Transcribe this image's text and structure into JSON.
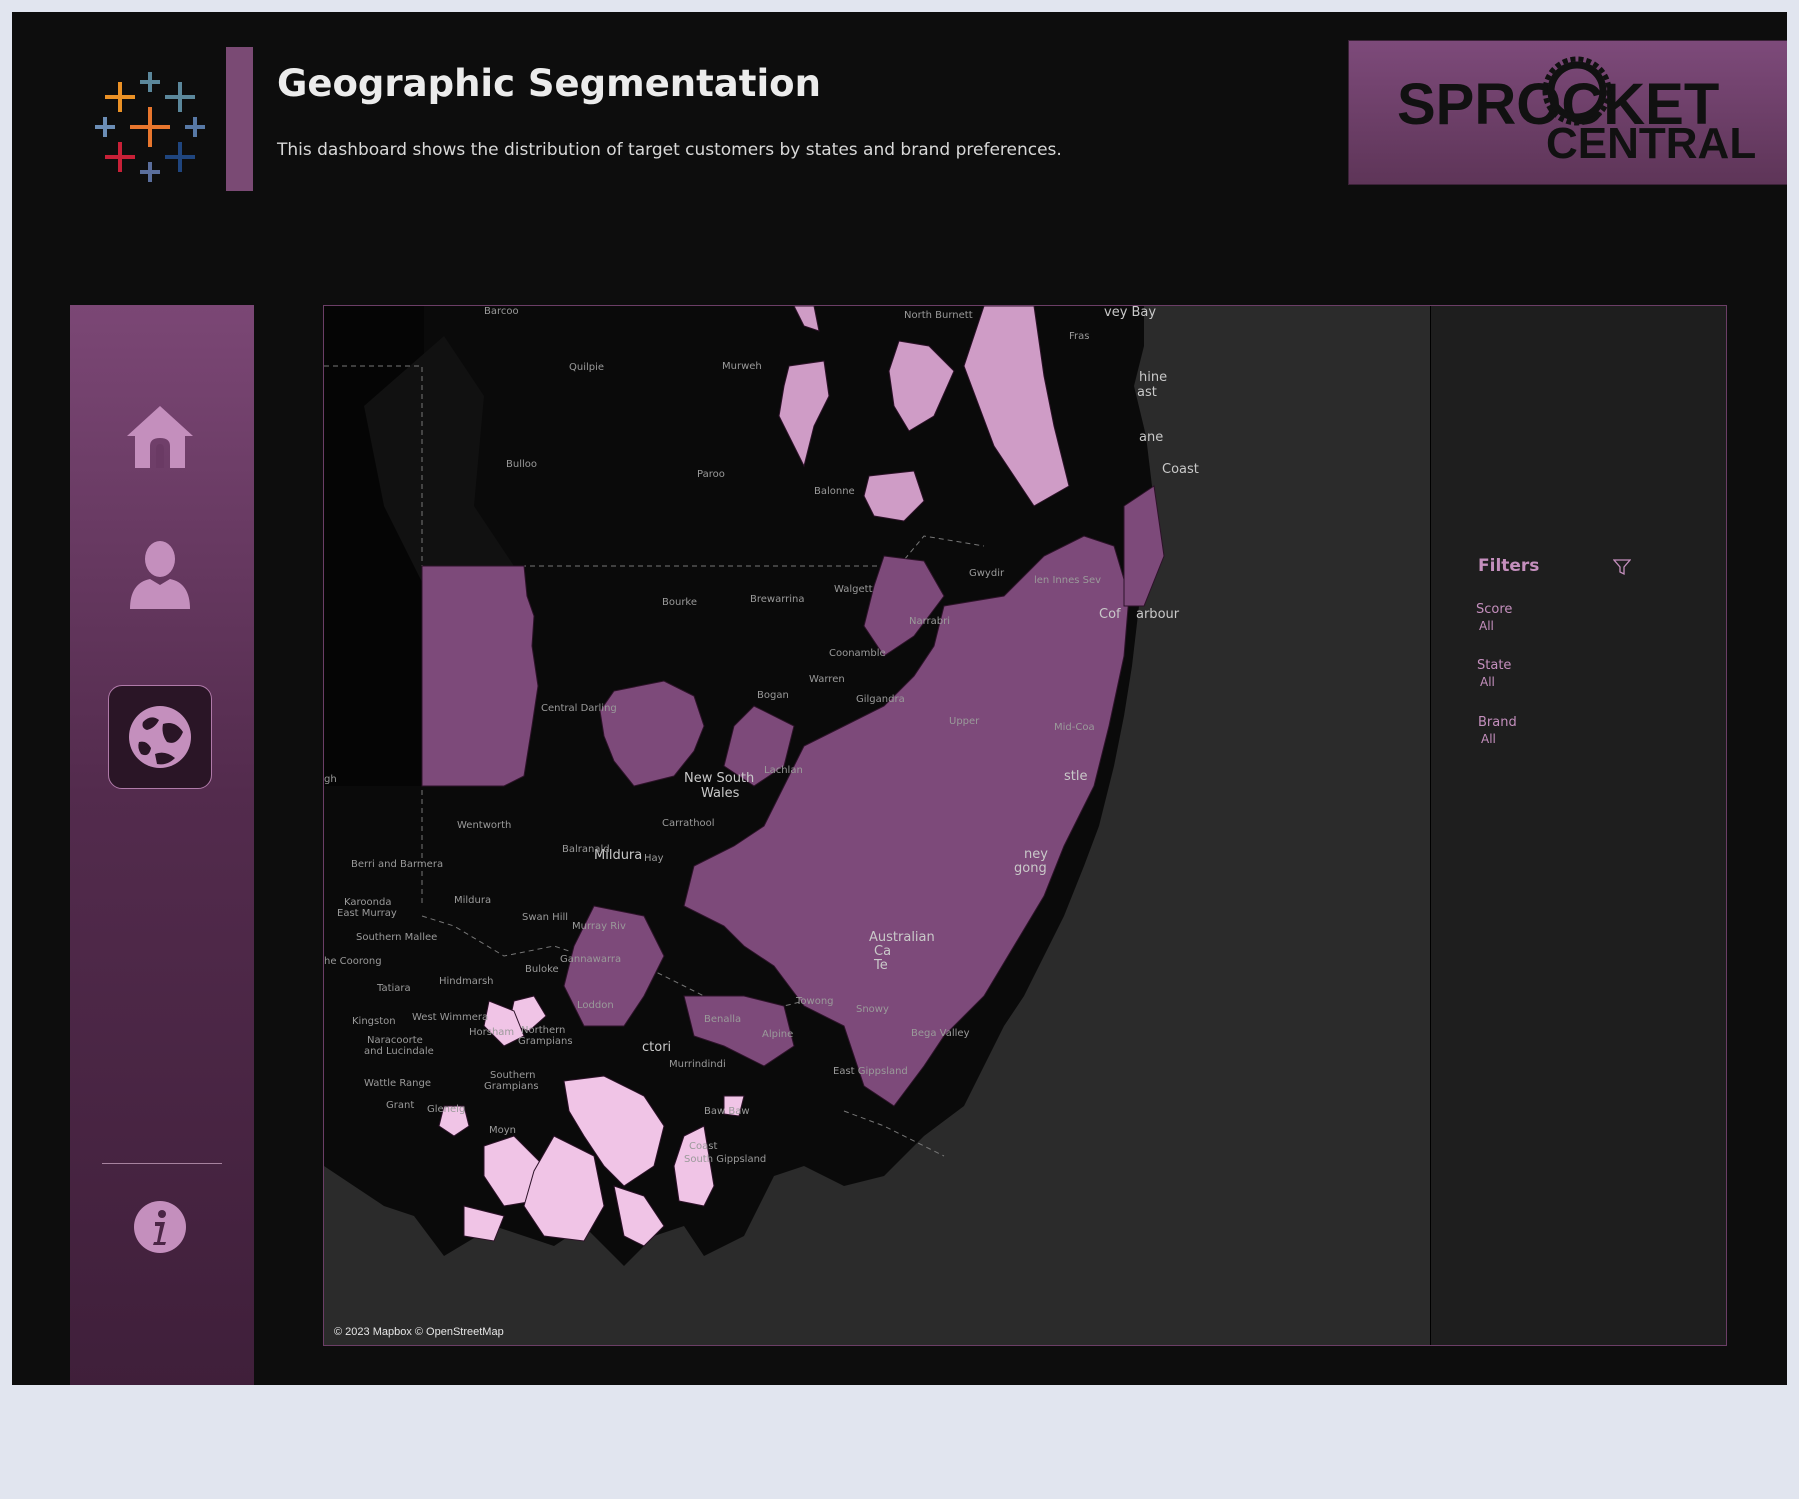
{
  "header": {
    "title": "Geographic Segmentation",
    "subtitle": "This dashboard shows the distribution of target customers by states and brand preferences."
  },
  "brand": {
    "line1": "SPROCKET",
    "line2": "CENTRAL"
  },
  "sidebar": {
    "items": [
      {
        "icon": "home-icon",
        "active": false
      },
      {
        "icon": "user-icon",
        "active": false
      },
      {
        "icon": "globe-icon",
        "active": true
      },
      {
        "icon": "info-icon",
        "active": false
      }
    ]
  },
  "map": {
    "attribution": "© 2023 Mapbox © OpenStreetMap",
    "labels": {
      "barcoo": "Barcoo",
      "north_burnett": "North Burnett",
      "hervey_bay": "vey Bay",
      "fraser": "Fras",
      "quilpie": "Quilpie",
      "murweh": "Murweh",
      "sunshine": "hine",
      "sunshine2": "ast",
      "bulloo": "Bulloo",
      "paroo": "Paroo",
      "balonne": "Balonne",
      "brisbane": "ane",
      "gold_coast": "Coast",
      "bourke": "Bourke",
      "brewarrina": "Brewarrina",
      "walgett": "Walgett",
      "gwydir": "Gwydir",
      "glen_innes": "len Innes Sev",
      "narrabri": "Narrabri",
      "coffs": "Cof",
      "coffs2": "arbour",
      "coonamble": "Coonamble",
      "warren": "Warren",
      "bogan": "Bogan",
      "gilgandra": "Gilgandra",
      "central_darling": "Central Darling",
      "upper": "Upper",
      "mid_coast": "Mid-Coa",
      "lachlan": "Lachlan",
      "nsw1": "New South",
      "nsw2": "Wales",
      "newcastle": "stle",
      "wentworth": "Wentworth",
      "carrathool": "Carrathool",
      "mildura_city": "Mildura",
      "balranald": "Balranald",
      "hay": "Hay",
      "sydney": "ney",
      "wollongong": "gong",
      "berri": "Berri and Barmera",
      "karoonda1": "Karoonda",
      "karoonda2": "East Murray",
      "mildura": "Mildura",
      "swan_hill": "Swan Hill",
      "murray_river": "Murray Riv",
      "southern_mallee": "Southern Mallee",
      "coorong": "he Coorong",
      "buloke": "Buloke",
      "gannawarra": "Gannawarra",
      "hindmarsh": "Hindmarsh",
      "tatiara": "Tatiara",
      "act1": "Australian",
      "act2": "Ca",
      "act3": "Te",
      "snowy": "Snowy",
      "towong": "Towong",
      "kingston": "Kingston",
      "west_wimmera": "West Wimmera",
      "loddon": "Loddon",
      "benalla": "Benalla",
      "alpine": "Alpine",
      "naracoorte1": "Naracoorte",
      "naracoorte2": "and Lucindale",
      "horsham": "Horsham",
      "northern_g1": "Northern",
      "northern_g2": "Grampians",
      "bega": "Bega Valley",
      "victoria": "ctori",
      "murrindindi": "Murrindindi",
      "east_gippsland": "East Gippsland",
      "wattle": "Wattle Range",
      "southern_g1": "Southern",
      "southern_g2": "Grampians",
      "grant": "Grant",
      "glenelg": "Glenelg",
      "baw_baw": "Baw Baw",
      "moyne": "Moyn",
      "coast": "Coast",
      "south_gippsland": "South Gippsland",
      "gh": "gh"
    }
  },
  "filters": {
    "title": "Filters",
    "icon": "funnel-icon",
    "items": [
      {
        "label": "Score",
        "value": "All"
      },
      {
        "label": "State",
        "value": "All"
      },
      {
        "label": "Brand",
        "value": "All"
      }
    ]
  },
  "colors": {
    "accent": "#7a4a74",
    "filter_text": "#c48fbd",
    "region_mid": "#7d4a7a",
    "region_light": "#cf9cc6",
    "region_pale": "#f0c4e6"
  }
}
